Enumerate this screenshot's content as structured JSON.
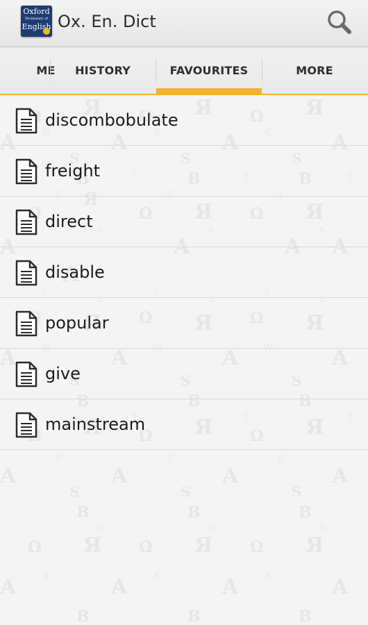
{
  "app": {
    "title": "Ox. En. Dict"
  },
  "logo": {
    "line1": "Oxford",
    "line2": "Dictionary of",
    "line3": "English"
  },
  "tabs": [
    {
      "label": "HOME",
      "visible_text": "ME"
    },
    {
      "label": "HISTORY"
    },
    {
      "label": "FAVOURITES",
      "selected": true
    },
    {
      "label": "MORE"
    }
  ],
  "favourites": [
    {
      "word": "discombobulate"
    },
    {
      "word": "freight"
    },
    {
      "word": "direct"
    },
    {
      "word": "disable"
    },
    {
      "word": "popular"
    },
    {
      "word": "give"
    },
    {
      "word": "mainstream"
    }
  ],
  "icons": {
    "search": "search-icon",
    "document": "document-icon"
  },
  "colors": {
    "accent": "#f3b22b",
    "logo_bg": "#1c3c74",
    "text": "#1b1b1b"
  }
}
